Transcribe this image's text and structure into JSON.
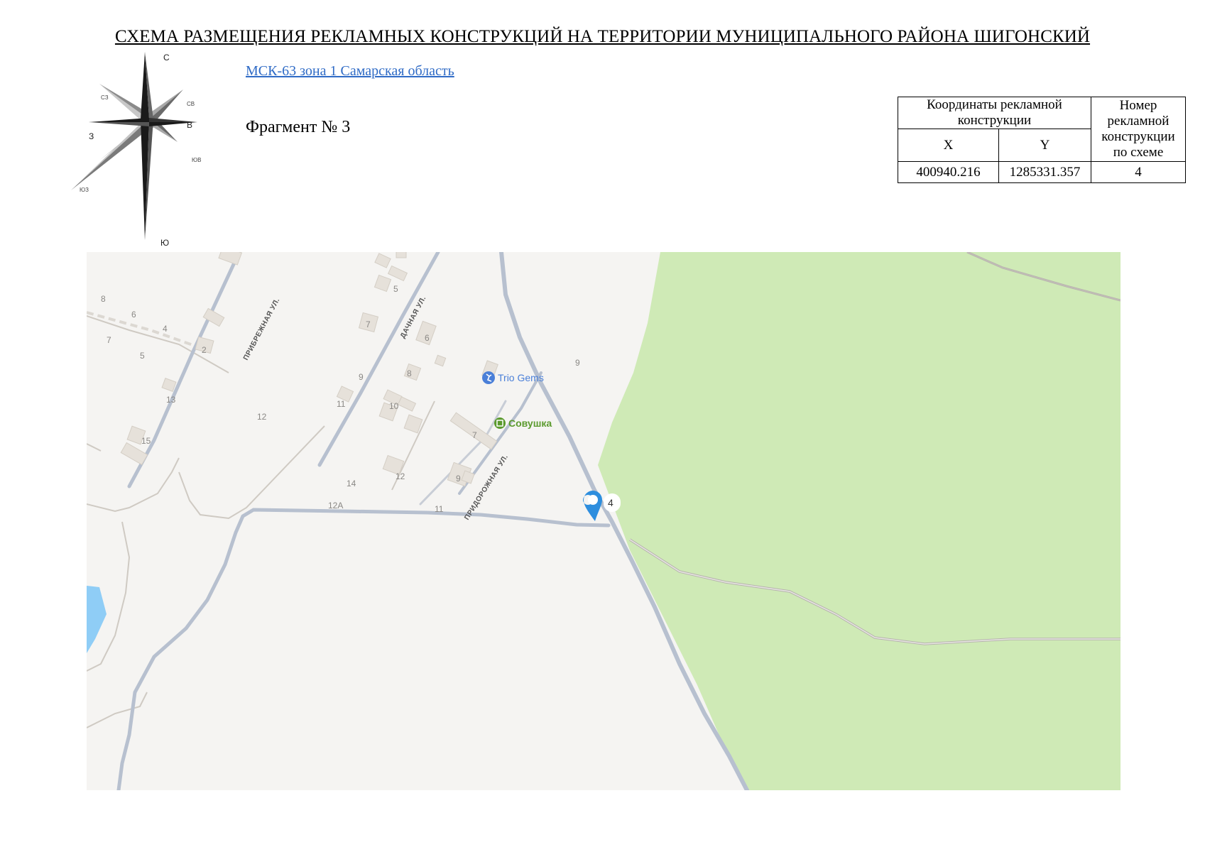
{
  "title": "СХЕМА РАЗМЕЩЕНИЯ РЕКЛАМНЫХ КОНСТРУКЦИЙ НА ТЕРРИТОРИИ МУНИЦИПАЛЬНОГО РАЙОНА ШИГОНСКИЙ",
  "crs_link": "МСК-63 зона 1 Самарская область",
  "fragment": "Фрагмент № 3",
  "compass": {
    "icon": "compass-rose-icon",
    "n": "С",
    "ne": "СВ",
    "e": "В",
    "se": "ЮВ",
    "s": "Ю",
    "sw": "ЮЗ",
    "w": "З",
    "nw": "СЗ"
  },
  "table": {
    "coords_header": "Координаты рекламной конструкции",
    "number_header": "Номер рекламной конструкции по схеме",
    "x_header": "X",
    "y_header": "Y",
    "rows": [
      {
        "x": "400940.216",
        "y": "1285331.357",
        "number": "4"
      }
    ]
  },
  "map": {
    "colors": {
      "land": "#f5f4f2",
      "forest": "#cfeab6",
      "water": "#8fcdf6",
      "road": "#b7c0cf",
      "building": "#e6e1da",
      "marker": "#2e8ede"
    },
    "streets": [
      "ПРИБРЕЖНАЯ УЛ.",
      "ДАЧНАЯ УЛ.",
      "ПРИДОРОЖНАЯ УЛ."
    ],
    "house_numbers": [
      "8",
      "6",
      "4",
      "7",
      "5",
      "2",
      "13",
      "15",
      "12",
      "5",
      "7",
      "6",
      "9",
      "8",
      "11",
      "10",
      "7",
      "12",
      "9",
      "14",
      "12А",
      "11",
      "9"
    ],
    "poi": [
      {
        "name": "Trio Gems",
        "icon": "figure-skating-icon",
        "color": "#4a7fd8"
      },
      {
        "name": "Совушка",
        "icon": "kindergarten-icon",
        "color": "#5b9a2e"
      }
    ],
    "marker": {
      "icon": "map-pin-icon",
      "label": "4"
    }
  }
}
